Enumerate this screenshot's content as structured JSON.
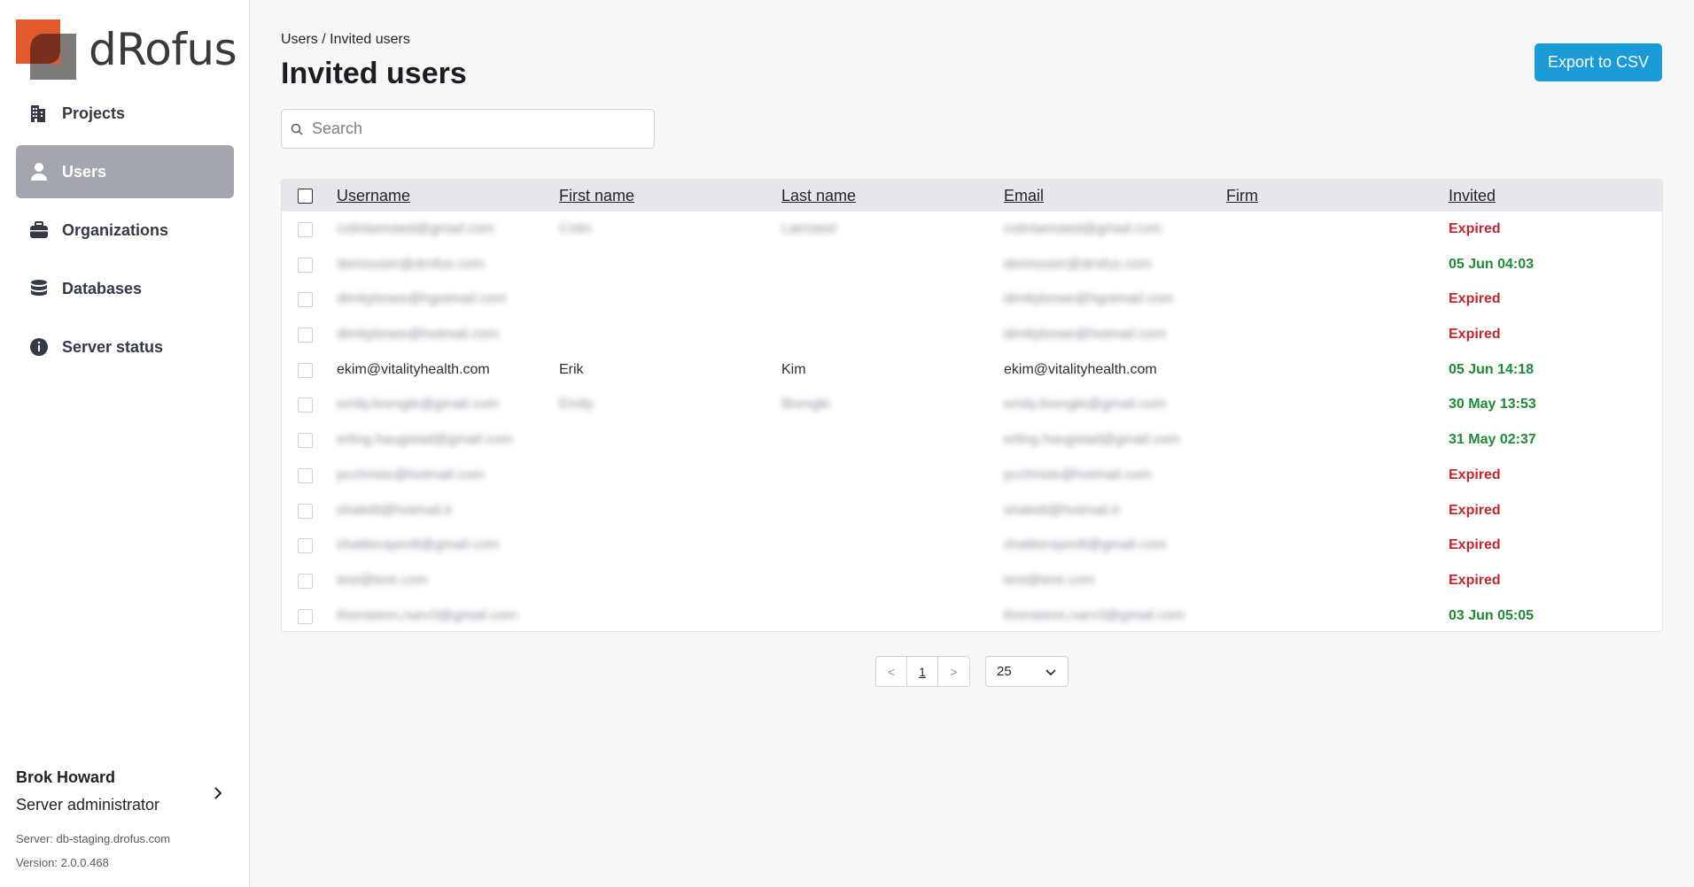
{
  "app": {
    "logo_text": "dRofus"
  },
  "sidebar": {
    "items": [
      {
        "label": "Projects",
        "icon": "building-icon",
        "active": false
      },
      {
        "label": "Users",
        "icon": "user-icon",
        "active": true
      },
      {
        "label": "Organizations",
        "icon": "briefcase-icon",
        "active": false
      },
      {
        "label": "Databases",
        "icon": "database-icon",
        "active": false
      },
      {
        "label": "Server status",
        "icon": "info-icon",
        "active": false
      }
    ],
    "user": {
      "name": "Brok Howard",
      "role": "Server administrator"
    },
    "server": "Server: db-staging.drofus.com",
    "version": "Version: 2.0.0.468"
  },
  "header": {
    "breadcrumb": "Users / Invited users",
    "title": "Invited users",
    "export_label": "Export to CSV"
  },
  "search": {
    "placeholder": "Search",
    "value": ""
  },
  "table": {
    "columns": [
      "Username",
      "First name",
      "Last name",
      "Email",
      "Firm",
      "Invited"
    ],
    "rows": [
      {
        "username": "colinlamsted@gmail.com",
        "first": "Colin",
        "last": "Lamsted",
        "email": "colinlamsted@gmail.com",
        "firm": "",
        "invited": "Expired",
        "status": "expired",
        "blurred": true
      },
      {
        "username": "demouser@drofus.com",
        "first": "",
        "last": "",
        "email": "demouser@drofus.com",
        "firm": "",
        "invited": "05 Jun 04:03",
        "status": "date",
        "blurred": true
      },
      {
        "username": "dimitybowe@hgotmail.com",
        "first": "",
        "last": "",
        "email": "dimitybowe@hgotmail.com",
        "firm": "",
        "invited": "Expired",
        "status": "expired",
        "blurred": true
      },
      {
        "username": "dimitybowe@hotmail.com",
        "first": "",
        "last": "",
        "email": "dimitybowe@hotmail.com",
        "firm": "",
        "invited": "Expired",
        "status": "expired",
        "blurred": true
      },
      {
        "username": "ekim@vitalityhealth.com",
        "first": "Erik",
        "last": "Kim",
        "email": "ekim@vitalityhealth.com",
        "firm": "",
        "invited": "05 Jun 14:18",
        "status": "date",
        "blurred": false
      },
      {
        "username": "emily.brengle@gmail.com",
        "first": "Emily",
        "last": "Brengle",
        "email": "emily.brengle@gmail.com",
        "firm": "",
        "invited": "30 May 13:53",
        "status": "date",
        "blurred": true
      },
      {
        "username": "erling.haugstad@gmail.com",
        "first": "",
        "last": "",
        "email": "erling.haugstad@gmail.com",
        "firm": "",
        "invited": "31 May 02:37",
        "status": "date",
        "blurred": true
      },
      {
        "username": "pcchriste@hotmail.com",
        "first": "",
        "last": "",
        "email": "pcchriste@hotmail.com",
        "firm": "",
        "invited": "Expired",
        "status": "expired",
        "blurred": true
      },
      {
        "username": "shaleitl@hotmail.it",
        "first": "",
        "last": "",
        "email": "shaleitl@hotmail.it",
        "firm": "",
        "invited": "Expired",
        "status": "expired",
        "blurred": true
      },
      {
        "username": "shaliterayesft@gmail.com",
        "first": "",
        "last": "",
        "email": "shaliterayesft@gmail.com",
        "firm": "",
        "invited": "Expired",
        "status": "expired",
        "blurred": true
      },
      {
        "username": "test@test.com",
        "first": "",
        "last": "",
        "email": "test@test.com",
        "firm": "",
        "invited": "Expired",
        "status": "expired",
        "blurred": true
      },
      {
        "username": "thorsteinn.narv3@gmail.com",
        "first": "",
        "last": "",
        "email": "thorsteinn.narv3@gmail.com",
        "firm": "",
        "invited": "03 Jun 05:05",
        "status": "date",
        "blurred": true
      }
    ]
  },
  "pagination": {
    "prev": "<",
    "current": "1",
    "next": ">",
    "page_size": "25"
  },
  "colors": {
    "accent": "#1a9bd7",
    "expired": "#c0262d",
    "date": "#1f8a36",
    "active_nav": "#a3a6ae"
  }
}
